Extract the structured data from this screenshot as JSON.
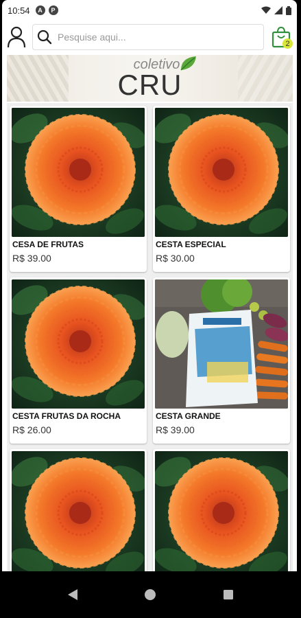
{
  "status": {
    "time": "10:54",
    "app_icons": [
      "A",
      "P"
    ]
  },
  "header": {
    "search_placeholder": "Pesquise aqui...",
    "cart_count": "2"
  },
  "banner": {
    "brand_top": "coletivo",
    "brand_main": "CRU"
  },
  "products": [
    {
      "name": "CESA DE FRUTAS",
      "price": "R$ 39.00",
      "image": "orange-dahlia"
    },
    {
      "name": "CESTA ESPECIAL",
      "price": "R$ 30.00",
      "image": "orange-dahlia"
    },
    {
      "name": "CESTA FRUTAS DA ROCHA",
      "price": "R$ 26.00",
      "image": "orange-dahlia"
    },
    {
      "name": "CESTA GRANDE",
      "price": "R$ 39.00",
      "image": "vegetable-basket"
    },
    {
      "name": "",
      "price": "",
      "image": "orange-dahlia"
    },
    {
      "name": "",
      "price": "",
      "image": "orange-dahlia"
    }
  ],
  "colors": {
    "accent": "#2f8f3a",
    "badge": "#d9e63a",
    "grid_bg": "#efefef"
  },
  "icons": [
    "user-icon",
    "search-icon",
    "shopping-bag-icon",
    "back-icon",
    "home-icon",
    "recents-icon",
    "wifi-icon",
    "signal-icon",
    "battery-icon"
  ]
}
